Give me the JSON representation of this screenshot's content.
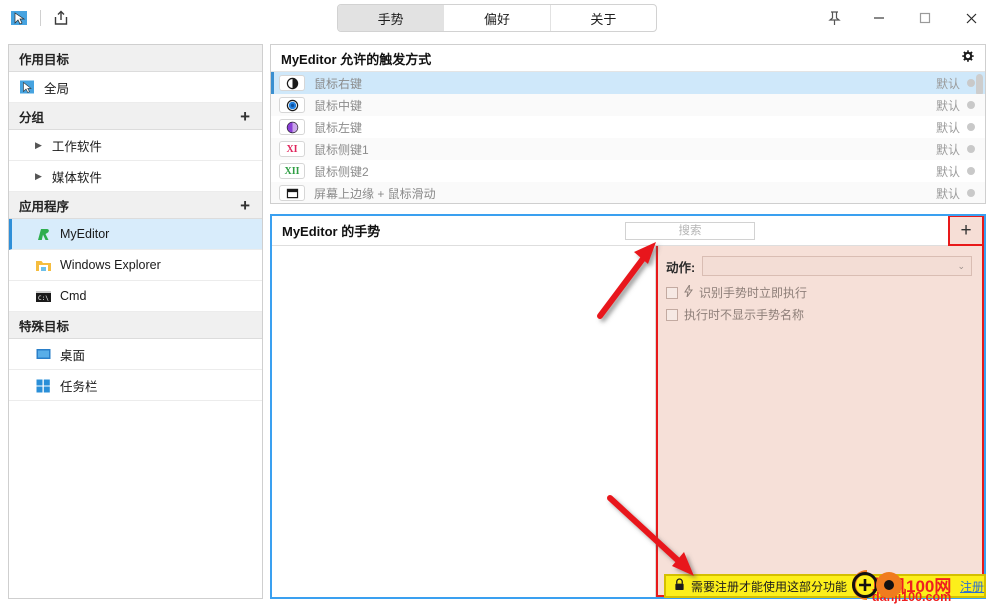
{
  "titlebar": {
    "app_icon": "cursor-app-icon",
    "export_icon": "export-icon",
    "tabs": [
      {
        "label": "手势",
        "active": true
      },
      {
        "label": "偏好",
        "active": false
      },
      {
        "label": "关于",
        "active": false
      }
    ],
    "pin_label": "📌",
    "minimize_label": "—",
    "maximize_label": "□",
    "close_label": "✕"
  },
  "sidebar": {
    "sections": [
      {
        "header": "作用目标",
        "add": "",
        "items": [
          {
            "label": "全局",
            "icon": "cursor-icon",
            "indent": false,
            "selected": false,
            "arrow": ""
          }
        ]
      },
      {
        "header": "分组",
        "add": "+",
        "items": [
          {
            "label": "工作软件",
            "icon": "",
            "indent": true,
            "selected": false,
            "arrow": "▶"
          },
          {
            "label": "媒体软件",
            "icon": "",
            "indent": true,
            "selected": false,
            "arrow": "▶"
          }
        ]
      },
      {
        "header": "应用程序",
        "add": "+",
        "items": [
          {
            "label": "MyEditor",
            "icon": "myeditor-icon",
            "indent": true,
            "selected": true,
            "arrow": ""
          },
          {
            "label": "Windows Explorer",
            "icon": "folder-icon",
            "indent": true,
            "selected": false,
            "arrow": ""
          },
          {
            "label": "Cmd",
            "icon": "cmd-icon",
            "indent": true,
            "selected": false,
            "arrow": ""
          }
        ]
      },
      {
        "header": "特殊目标",
        "add": "",
        "items": [
          {
            "label": "桌面",
            "icon": "desktop-icon",
            "indent": true,
            "selected": false,
            "arrow": ""
          },
          {
            "label": "任务栏",
            "icon": "taskbar-icon",
            "indent": true,
            "selected": false,
            "arrow": ""
          }
        ]
      }
    ]
  },
  "trigger_panel": {
    "title": "MyEditor 允许的触发方式",
    "gear_icon": "gear-icon",
    "rows": [
      {
        "label": "鼠标右键",
        "badge": "right-button-icon",
        "status": "默认",
        "selected": true
      },
      {
        "label": "鼠标中键",
        "badge": "middle-button-icon",
        "status": "默认",
        "selected": false
      },
      {
        "label": "鼠标左键",
        "badge": "left-button-icon",
        "status": "默认",
        "selected": false
      },
      {
        "label": "鼠标侧键1",
        "badge": "XI",
        "status": "默认",
        "selected": false
      },
      {
        "label": "鼠标侧键2",
        "badge": "XII",
        "status": "默认",
        "selected": false
      },
      {
        "label": "屏幕上边缘 + 鼠标滑动",
        "badge": "screen-edge-icon",
        "status": "默认",
        "selected": false
      }
    ]
  },
  "gesture_panel": {
    "title": "MyEditor 的手势",
    "search_placeholder": "搜索",
    "add_label": "+",
    "action": {
      "label": "动作:",
      "value": "",
      "caret": "⌄",
      "checkboxes": [
        {
          "label": "识别手势时立即执行",
          "checked": false,
          "icon": "lightning-icon"
        },
        {
          "label": "执行时不显示手势名称",
          "checked": false,
          "icon": ""
        }
      ]
    }
  },
  "license_bar": {
    "lock_icon": "lock-icon",
    "message": "需要注册才能使用这部分功能",
    "register_link": "注册"
  },
  "watermark": {
    "top": "单机100网",
    "bottom": "danji100.com"
  },
  "colors": {
    "accent_blue": "#3aa0f0",
    "highlight_red": "#e8191a",
    "license_yellow": "#fcef1b",
    "selection_blue": "#cfe8fa",
    "watermark_red": "#ef1f20"
  }
}
